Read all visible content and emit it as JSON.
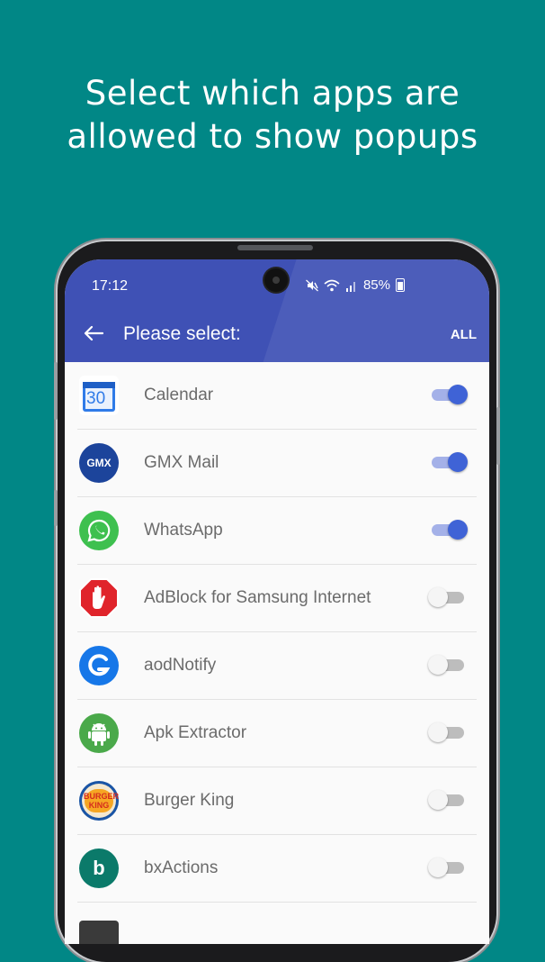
{
  "headline": {
    "line1": "Select which apps are",
    "line2": "allowed to show popups"
  },
  "status_bar": {
    "time": "17:12",
    "battery": "85%",
    "icons": [
      "mute-icon",
      "wifi-icon",
      "signal-icon",
      "battery-icon"
    ]
  },
  "app_bar": {
    "title": "Please select:",
    "all_label": "ALL",
    "back_icon": "arrow-left-icon"
  },
  "apps": [
    {
      "name": "Calendar",
      "enabled": true,
      "icon_text": "30",
      "icon": "calendar-icon"
    },
    {
      "name": "GMX Mail",
      "enabled": true,
      "icon_text": "GMX",
      "icon": "gmx-mail-icon"
    },
    {
      "name": "WhatsApp",
      "enabled": true,
      "icon_text": "",
      "icon": "whatsapp-icon"
    },
    {
      "name": "AdBlock for Samsung Internet",
      "enabled": false,
      "icon_text": "",
      "icon": "adblock-hand-icon"
    },
    {
      "name": "aodNotify",
      "enabled": false,
      "icon_text": "",
      "icon": "aodnotify-icon"
    },
    {
      "name": "Apk Extractor",
      "enabled": false,
      "icon_text": "",
      "icon": "android-icon"
    },
    {
      "name": "Burger King",
      "enabled": false,
      "icon_text": "BURGER KING",
      "icon": "burger-king-icon"
    },
    {
      "name": "bxActions",
      "enabled": false,
      "icon_text": "b",
      "icon": "bxactions-icon"
    }
  ],
  "colors": {
    "background": "#018786",
    "primary": "#3f51b5",
    "toggle_on": "#3f63d6",
    "toggle_track_on": "#a4b1e8"
  }
}
